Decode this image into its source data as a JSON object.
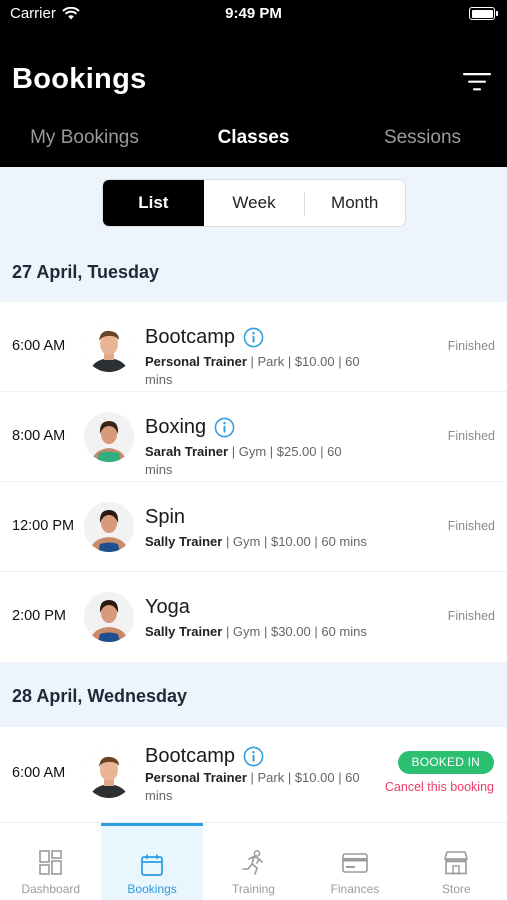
{
  "status_bar": {
    "carrier": "Carrier",
    "time": "9:49 PM"
  },
  "header": {
    "title": "Bookings"
  },
  "top_tabs": [
    {
      "label": "My Bookings",
      "active": false
    },
    {
      "label": "Classes",
      "active": true
    },
    {
      "label": "Sessions",
      "active": false
    }
  ],
  "view_toggle": {
    "options": [
      "List",
      "Week",
      "Month"
    ],
    "selected": "List"
  },
  "days": [
    {
      "label": "27 April, Tuesday",
      "classes": [
        {
          "time": "6:00 AM",
          "name": "Bootcamp",
          "trainer": "Personal Trainer",
          "details": " | Park | $10.00 | 60 mins",
          "status": "Finished",
          "avatar": "male-trainer"
        },
        {
          "time": "8:00 AM",
          "name": "Boxing",
          "trainer": "Sarah Trainer",
          "details": " | Gym | $25.00 | 60 mins",
          "status": "Finished",
          "avatar": "female-trainer-green"
        },
        {
          "time": "12:00 PM",
          "name": "Spin",
          "trainer": "Sally Trainer",
          "details": " | Gym | $10.00 | 60 mins",
          "status": "Finished",
          "avatar": "female-trainer-blue"
        },
        {
          "time": "2:00 PM",
          "name": "Yoga",
          "trainer": "Sally Trainer",
          "details": " | Gym | $30.00 | 60 mins",
          "status": "Finished",
          "avatar": "female-trainer-blue"
        }
      ]
    },
    {
      "label": "28 April, Wednesday",
      "classes": [
        {
          "time": "6:00 AM",
          "name": "Bootcamp",
          "trainer": "Personal Trainer",
          "details": " | Park | $10.00 | 60 mins",
          "badge": "BOOKED IN",
          "action": "Cancel this booking",
          "avatar": "male-trainer"
        }
      ]
    }
  ],
  "tabbar": [
    {
      "label": "Dashboard",
      "icon": "dashboard-icon",
      "active": false
    },
    {
      "label": "Bookings",
      "icon": "calendar-icon",
      "active": true
    },
    {
      "label": "Training",
      "icon": "running-icon",
      "active": false
    },
    {
      "label": "Finances",
      "icon": "credit-card-icon",
      "active": false
    },
    {
      "label": "Store",
      "icon": "store-icon",
      "active": false
    }
  ],
  "colors": {
    "accent": "#2b9de0",
    "booked": "#2bbf72",
    "cancel": "#f0396a",
    "header_bg": "#000000",
    "section_bg": "#eef4fb"
  }
}
